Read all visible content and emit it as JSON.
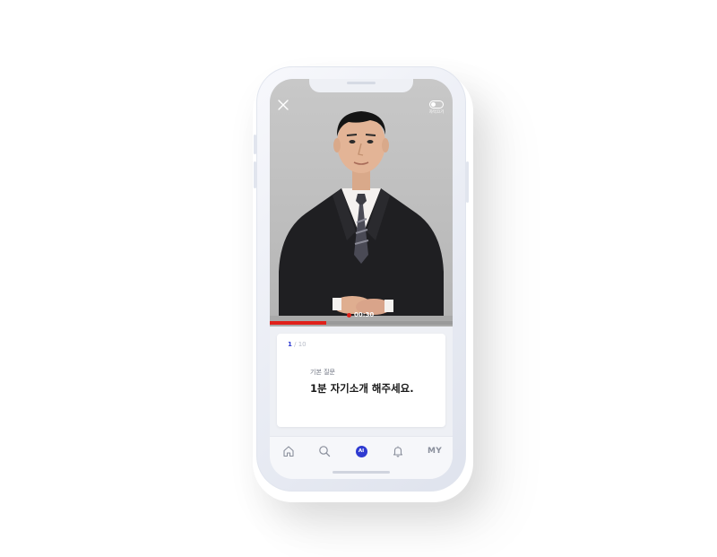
{
  "video": {
    "toggle_label": "자막끄기",
    "timer": "00:30",
    "progress_fraction": 0.31
  },
  "question": {
    "current": "1",
    "separator": " / ",
    "total": "10",
    "category": "기본 질문",
    "text": "1분 자기소개 해주세요."
  },
  "nav": {
    "items": [
      {
        "name": "home",
        "icon": "home-icon"
      },
      {
        "name": "search",
        "icon": "search-icon"
      },
      {
        "name": "ai",
        "icon": "ai-badge-icon",
        "label": "AI"
      },
      {
        "name": "notifications",
        "icon": "bell-icon"
      },
      {
        "name": "my",
        "label": "MY"
      }
    ]
  },
  "colors": {
    "accent": "#2f3bd1",
    "record": "#e0201a",
    "background": "#eef0f5"
  }
}
